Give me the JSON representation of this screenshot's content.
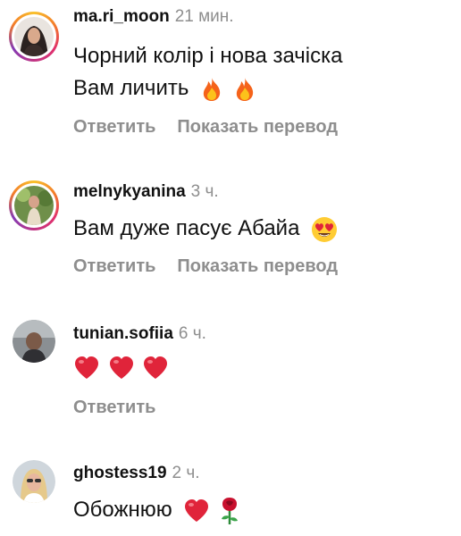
{
  "comments": [
    {
      "username": "ma.ri_moon",
      "time": "21 мин.",
      "text_line1": "Чорний колір і нова зачіска",
      "text_line2": "Вам личить",
      "emojis": [
        "fire-emoji",
        "fire-emoji"
      ],
      "reply_label": "Ответить",
      "translate_label": "Показать перевод",
      "has_story_ring": true
    },
    {
      "username": "melnykyanina",
      "time": "3 ч.",
      "text_line1": "Вам дуже пасує Абайа",
      "emojis": [
        "heart-eyes-emoji"
      ],
      "reply_label": "Ответить",
      "translate_label": "Показать перевод",
      "has_story_ring": true
    },
    {
      "username": "tunian.sofiia",
      "time": "6 ч.",
      "text_line1": "",
      "emojis": [
        "red-heart-emoji",
        "red-heart-emoji",
        "red-heart-emoji"
      ],
      "reply_label": "Ответить",
      "has_story_ring": false
    },
    {
      "username": "ghostess19",
      "time": "2 ч.",
      "text_line1": "Обожнюю",
      "emojis": [
        "red-heart-emoji",
        "rose-emoji"
      ],
      "has_story_ring": false
    }
  ],
  "colors": {
    "text": "#111111",
    "muted": "#8e8e8e",
    "heart": "#e0243a",
    "background": "#ffffff"
  }
}
